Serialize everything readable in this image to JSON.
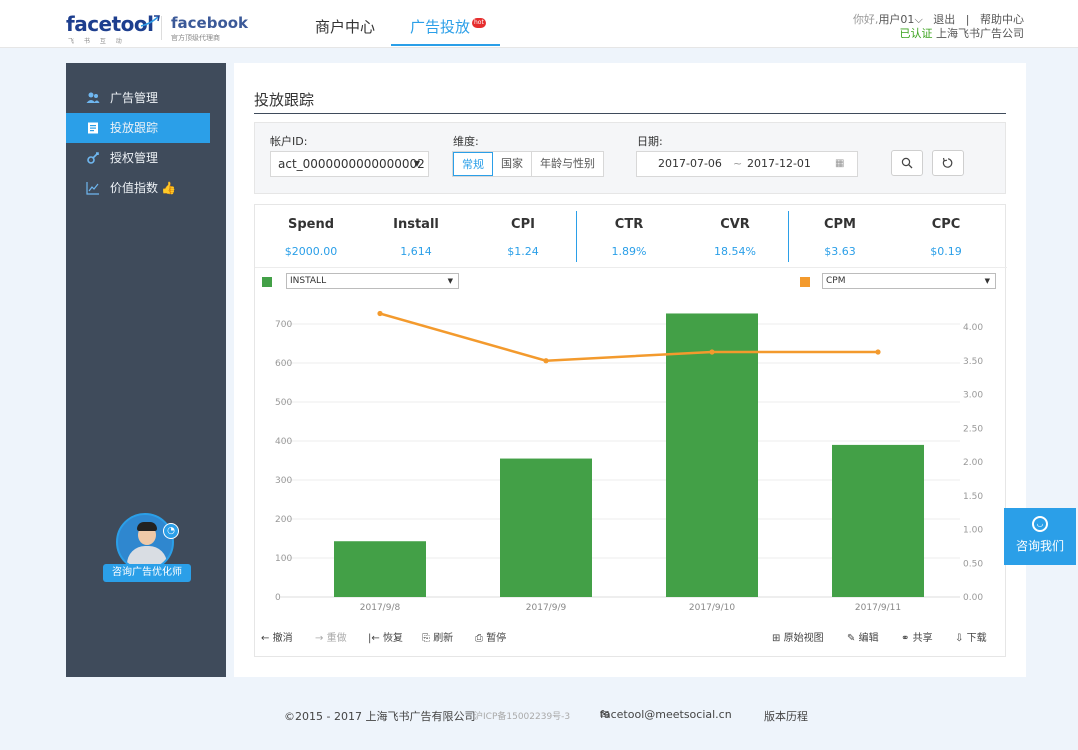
{
  "header": {
    "brand_logo": "facetool",
    "brand_sub": "飞 书 互 动",
    "partner_logo": "facebook",
    "partner_sub": "官方顶级代理商",
    "nav": [
      {
        "label": "商户中心"
      },
      {
        "label": "广告投放",
        "badge": "hot"
      }
    ],
    "greeting": "你好,",
    "username": "用户01",
    "logout": "退出",
    "divider": "|",
    "help": "帮助中心",
    "verified": "已认证",
    "company": "上海飞书广告公司",
    "accent_color": "#2b9fe8"
  },
  "sidebar": {
    "items": [
      {
        "label": "广告管理",
        "icon": "users-icon"
      },
      {
        "label": "投放跟踪",
        "icon": "document-icon",
        "active": true
      },
      {
        "label": "授权管理",
        "icon": "key-icon"
      },
      {
        "label": "价值指数",
        "icon": "trend-icon",
        "badge_icon": "thumb-up-icon"
      }
    ],
    "advisor_label": "咨询广告优化师"
  },
  "main": {
    "title": "投放跟踪",
    "filters": {
      "account_label": "帐户ID:",
      "account_value": "act_0000000000000002",
      "dimension_label": "维度:",
      "dimension_options": [
        "常规",
        "国家",
        "年龄与性别"
      ],
      "dimension_selected": "常规",
      "date_label": "日期:",
      "date_start": "2017-07-06",
      "date_sep": "~",
      "date_end": "2017-12-01"
    },
    "metrics": [
      {
        "name": "Spend",
        "value": "$2000.00"
      },
      {
        "name": "Install",
        "value": "1,614"
      },
      {
        "name": "CPI",
        "value": "$1.24"
      },
      {
        "name": "CTR",
        "value": "1.89%"
      },
      {
        "name": "CVR",
        "value": "18.54%"
      },
      {
        "name": "CPM",
        "value": "$3.63"
      },
      {
        "name": "CPC",
        "value": "$0.19"
      }
    ],
    "left_select": "INSTALL",
    "right_select": "CPM",
    "toolbar_left": [
      "撤消",
      "重做",
      "恢复",
      "刷新",
      "暂停"
    ],
    "toolbar_right": [
      "原始视图",
      "编辑",
      "共享",
      "下载"
    ]
  },
  "chart_data": {
    "type": "bar",
    "categories": [
      "2017/9/8",
      "2017/9/9",
      "2017/9/10",
      "2017/9/11"
    ],
    "series": [
      {
        "name": "INSTALL",
        "type": "bar",
        "axis": "left",
        "color": "#43a047",
        "values": [
          143,
          355,
          727,
          390
        ]
      },
      {
        "name": "CPM",
        "type": "line",
        "axis": "right",
        "color": "#f39a2d",
        "values": [
          4.2,
          3.5,
          3.63,
          3.63
        ]
      }
    ],
    "y_left": {
      "min": 0,
      "max": 700,
      "ticks": [
        "0",
        "100",
        "200",
        "300",
        "400",
        "500",
        "600",
        "700"
      ]
    },
    "y_right": {
      "min": 0,
      "max": 4,
      "ticks": [
        "0.00",
        "0.50",
        "1.00",
        "1.50",
        "2.00",
        "2.50",
        "3.00",
        "3.50",
        "4.00"
      ]
    },
    "grid": true
  },
  "consult": {
    "label": "咨询我们"
  },
  "footer": {
    "copyright": "©2015 - 2017 上海飞书广告有限公司",
    "icp": "沪ICP备15002239号-3",
    "email": "facetool@meetsocial.cn",
    "history": "版本历程"
  }
}
